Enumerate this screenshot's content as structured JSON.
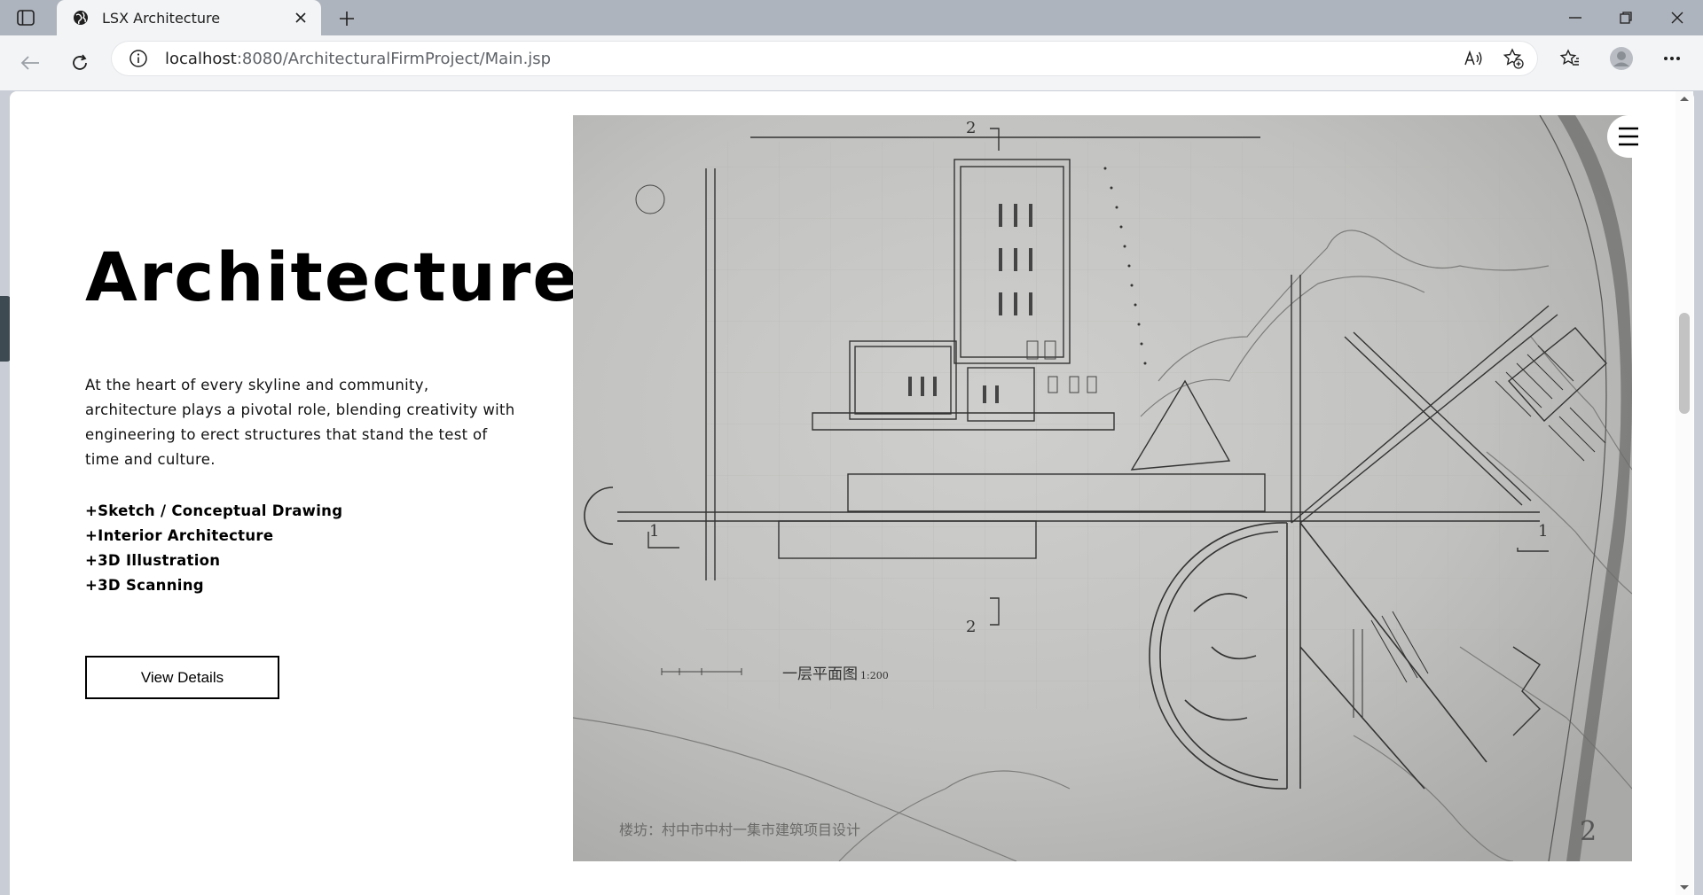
{
  "browser": {
    "tab_title": "LSX Architecture",
    "url_host": "localhost",
    "url_port": ":8080",
    "url_path": "/ArchitecturalFirmProject/Main.jsp"
  },
  "page": {
    "heading": "Architecture",
    "lead": "At the heart of every skyline and community, architecture plays a pivotal role, blending creativity with engineering to erect structures that stand the test of time and culture.",
    "services": [
      "+Sketch / Conceptual Drawing",
      "+Interior Architecture",
      "+3D Illustration",
      "+3D Scanning"
    ],
    "cta_label": "View Details"
  },
  "plan": {
    "title": "一层平面图",
    "scale": "1:200",
    "caption": "楼坊：村中市中村一集市建筑项目设计",
    "sheet_number": "2",
    "section_marks": [
      "1",
      "1",
      "2",
      "2"
    ]
  }
}
